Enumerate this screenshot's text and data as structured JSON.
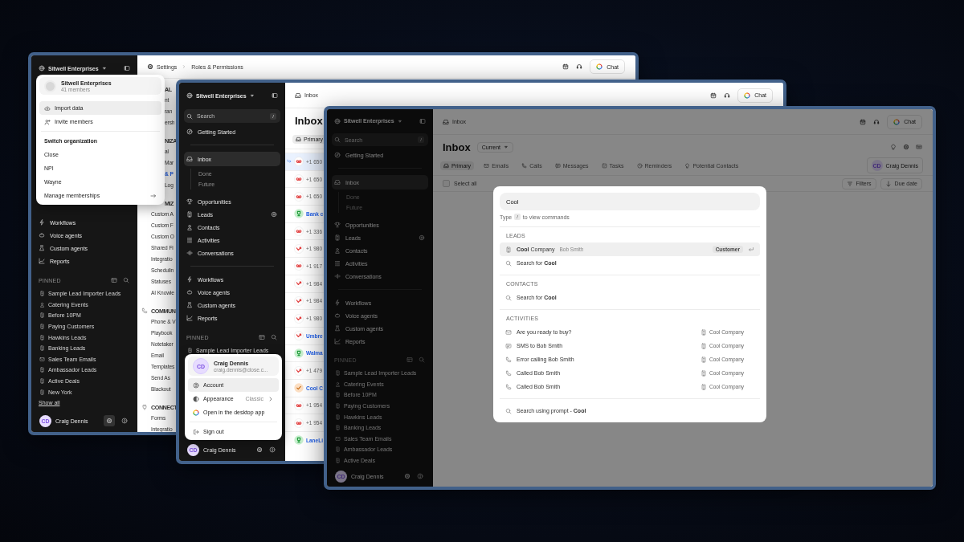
{
  "windows": [
    {
      "kind": "settings",
      "dimmed": false,
      "sidebar": {
        "workspace": "Sitwell Enterprises",
        "nav_groups": [
          {
            "items": [
              {
                "label": "Workflows",
                "kind": "workflows",
                "selected": false
              },
              {
                "label": "Voice agents",
                "kind": "voice_agents",
                "selected": false
              },
              {
                "label": "Custom agents",
                "kind": "custom_agents",
                "selected": false
              },
              {
                "label": "Reports",
                "kind": "reports",
                "selected": false
              }
            ]
          }
        ],
        "pinned_title": "PINNED",
        "pinned": [
          {
            "label": "Sample Lead Importer Leads",
            "kind": "lead_view"
          },
          {
            "label": "Catering Events",
            "kind": "contact_view"
          },
          {
            "label": "Before 10PM",
            "kind": "lead_view"
          },
          {
            "label": "Paying Customers",
            "kind": "lead_view"
          },
          {
            "label": "Hawkins Leads",
            "kind": "lead_view"
          },
          {
            "label": "Banking Leads",
            "kind": "lead_view"
          },
          {
            "label": "Sales Team Emails",
            "kind": "email_view"
          },
          {
            "label": "Ambassador Leads",
            "kind": "lead_view"
          },
          {
            "label": "Active Deals",
            "kind": "lead_view"
          },
          {
            "label": "New York",
            "kind": "lead_view"
          }
        ],
        "show_all": "Show all",
        "user": {
          "name": "Craig Dennis",
          "initials": "CD"
        }
      },
      "breadcrumb": [
        "Settings",
        "Roles & Permissions"
      ],
      "chat": "Chat",
      "settings_nav_top": [
        {
          "kind": "section",
          "label": "AL"
        },
        {
          "kind": "link",
          "label": "nt",
          "selected": false
        },
        {
          "kind": "link",
          "label": "ran",
          "selected": false
        },
        {
          "kind": "link",
          "label": "ersh",
          "selected": false
        },
        {
          "kind": "section",
          "label": "NIZA"
        },
        {
          "kind": "link",
          "label": "al",
          "selected": false
        },
        {
          "kind": "link",
          "label": "Mar",
          "selected": false
        },
        {
          "kind": "link",
          "label": "& P",
          "selected": true
        },
        {
          "kind": "link",
          "label": "Log",
          "selected": false
        },
        {
          "kind": "section",
          "label": "MIZ"
        }
      ],
      "settings_nav": [
        {
          "kind": "link",
          "label": "Custom A",
          "selected": false
        },
        {
          "kind": "link",
          "label": "Custom F",
          "selected": false
        },
        {
          "kind": "link",
          "label": "Custom O",
          "selected": false
        },
        {
          "kind": "link",
          "label": "Shared Fi",
          "selected": false
        },
        {
          "kind": "link",
          "label": "Integratio",
          "selected": false
        },
        {
          "kind": "link",
          "label": "Schedulin",
          "selected": false
        },
        {
          "kind": "link",
          "label": "Statuses",
          "selected": false
        },
        {
          "kind": "link",
          "label": "AI Knowle",
          "selected": false
        },
        {
          "kind": "communication_section",
          "label": "COMMUNI"
        },
        {
          "kind": "link",
          "label": "Phone & V",
          "selected": false
        },
        {
          "kind": "link",
          "label": "Playbook",
          "selected": false
        },
        {
          "kind": "link",
          "label": "Notetaker",
          "selected": false
        },
        {
          "kind": "link",
          "label": "Email",
          "selected": false
        },
        {
          "kind": "link",
          "label": "Templates",
          "selected": false
        },
        {
          "kind": "link",
          "label": "Send As",
          "selected": false
        },
        {
          "kind": "link",
          "label": "Blackout",
          "selected": false
        },
        {
          "kind": "connect_section",
          "label": "CONNECT"
        },
        {
          "kind": "link",
          "label": "Forms",
          "selected": false
        },
        {
          "kind": "link",
          "label": "Integratio",
          "selected": false
        }
      ],
      "workspace_menu": {
        "title": "Sitwell Enterprises",
        "subtitle": "41 members",
        "actions": [
          {
            "label": "Import data",
            "kind": "import",
            "selected": true
          },
          {
            "label": "Invite members",
            "kind": "invite",
            "selected": false
          }
        ],
        "heading": "Switch organization",
        "organizations": [
          "Close",
          "NPI",
          "Wayne"
        ],
        "manage": "Manage memberships"
      }
    },
    {
      "kind": "inbox",
      "dimmed": false,
      "sidebar": {
        "workspace": "Sitwell Enterprises",
        "search": "Search",
        "search_key": "/",
        "nav_groups": [
          {
            "items": [
              {
                "label": "Getting Started",
                "kind": "getting_started",
                "selected": false
              }
            ]
          },
          {
            "items": [
              {
                "label": "Inbox",
                "kind": "inbox",
                "selected": true,
                "children": [
                  {
                    "label": "Done",
                    "selected": false
                  },
                  {
                    "label": "Future",
                    "selected": false
                  }
                ]
              },
              {
                "label": "Opportunities",
                "kind": "opportunities",
                "selected": false
              },
              {
                "label": "Leads",
                "kind": "leads",
                "selected": false
              },
              {
                "label": "Contacts",
                "kind": "contacts",
                "selected": false
              },
              {
                "label": "Activities",
                "kind": "activities",
                "selected": false
              },
              {
                "label": "Conversations",
                "kind": "conversations",
                "selected": false
              }
            ]
          },
          {
            "items": [
              {
                "label": "Workflows",
                "kind": "workflows",
                "selected": false
              },
              {
                "label": "Voice agents",
                "kind": "voice_agents",
                "selected": false
              },
              {
                "label": "Custom agents",
                "kind": "custom_agents",
                "selected": false
              },
              {
                "label": "Reports",
                "kind": "reports",
                "selected": false
              }
            ]
          }
        ],
        "pinned_title": "PINNED",
        "pinned": [
          {
            "label": "Sample Lead Importer Leads",
            "kind": "lead_view"
          }
        ],
        "user": {
          "name": "Craig Dennis",
          "initials": "CD"
        }
      },
      "breadcrumb": [
        "Inbox"
      ],
      "chat": "Chat",
      "page_title": "Inbox",
      "tabs": [
        {
          "label": "Primary",
          "kind": "primary",
          "selected": true
        }
      ],
      "rows": [
        {
          "kind": "voicemail",
          "text": "+1 650",
          "link": false,
          "selected": true
        },
        {
          "kind": "voicemail",
          "text": "+1 650",
          "link": false,
          "selected": false
        },
        {
          "kind": "voicemail",
          "text": "+1 650",
          "link": false,
          "selected": false
        },
        {
          "kind": "opportunity",
          "text": "Bank c",
          "link": true,
          "selected": false
        },
        {
          "kind": "voicemail",
          "text": "+1 336",
          "link": false,
          "selected": false
        },
        {
          "kind": "missed_call",
          "text": "+1 980",
          "link": false,
          "selected": false
        },
        {
          "kind": "voicemail",
          "text": "+1 917",
          "link": false,
          "selected": false
        },
        {
          "kind": "missed_call",
          "text": "+1 984",
          "link": false,
          "selected": false
        },
        {
          "kind": "missed_call",
          "text": "+1 984",
          "link": false,
          "selected": false
        },
        {
          "kind": "missed_call",
          "text": "+1 980",
          "link": false,
          "selected": false
        },
        {
          "kind": "missed_call",
          "text": "Umbre",
          "link": true,
          "selected": false
        },
        {
          "kind": "opportunity",
          "text": "Walma",
          "link": true,
          "selected": false
        },
        {
          "kind": "missed_call",
          "text": "+1 479",
          "link": false,
          "selected": false
        },
        {
          "kind": "task",
          "text": "Cool C",
          "link": true,
          "selected": false
        },
        {
          "kind": "voicemail",
          "text": "+1 954",
          "link": false,
          "selected": false
        },
        {
          "kind": "voicemail",
          "text": "+1 954",
          "link": false,
          "selected": false
        },
        {
          "kind": "opportunity",
          "text": "LaneLi",
          "link": true,
          "selected": false
        }
      ],
      "user_menu": {
        "name": "Craig Dennis",
        "initials": "CD",
        "email": "craig.dennis@close.c...",
        "items": [
          {
            "label": "Account",
            "kind": "account",
            "selected": true
          },
          {
            "label": "Appearance",
            "kind": "appearance",
            "value": "Classic",
            "selected": false
          },
          {
            "label": "Open in the desktop app",
            "kind": "desktop",
            "selected": false
          },
          {
            "label": "Sign out",
            "kind": "sign_out",
            "selected": false
          }
        ]
      }
    },
    {
      "kind": "inbox",
      "dimmed": true,
      "sidebar": {
        "workspace": "Sitwell Enterprises",
        "search": "Search",
        "search_key": "/",
        "nav_groups": [
          {
            "items": [
              {
                "label": "Getting Started",
                "kind": "getting_started",
                "selected": false
              }
            ]
          },
          {
            "items": [
              {
                "label": "Inbox",
                "kind": "inbox",
                "selected": true,
                "children": [
                  {
                    "label": "Done",
                    "selected": false
                  },
                  {
                    "label": "Future",
                    "selected": false
                  }
                ]
              },
              {
                "label": "Opportunities",
                "kind": "opportunities",
                "selected": false
              },
              {
                "label": "Leads",
                "kind": "leads",
                "selected": false
              },
              {
                "label": "Contacts",
                "kind": "contacts",
                "selected": false
              },
              {
                "label": "Activities",
                "kind": "activities",
                "selected": false
              },
              {
                "label": "Conversations",
                "kind": "conversations",
                "selected": false
              }
            ]
          },
          {
            "items": [
              {
                "label": "Workflows",
                "kind": "workflows",
                "selected": false
              },
              {
                "label": "Voice agents",
                "kind": "voice_agents",
                "selected": false
              },
              {
                "label": "Custom agents",
                "kind": "custom_agents",
                "selected": false
              },
              {
                "label": "Reports",
                "kind": "reports",
                "selected": false
              }
            ]
          }
        ],
        "pinned_title": "PINNED",
        "pinned": [
          {
            "label": "Sample Lead Importer Leads",
            "kind": "lead_view"
          },
          {
            "label": "Catering Events",
            "kind": "contact_view"
          },
          {
            "label": "Before 10PM",
            "kind": "lead_view"
          },
          {
            "label": "Paying Customers",
            "kind": "lead_view"
          },
          {
            "label": "Hawkins Leads",
            "kind": "lead_view"
          },
          {
            "label": "Banking Leads",
            "kind": "lead_view"
          },
          {
            "label": "Sales Team Emails",
            "kind": "email_view"
          },
          {
            "label": "Ambassador Leads",
            "kind": "lead_view"
          },
          {
            "label": "Active Deals",
            "kind": "lead_view"
          }
        ],
        "user": {
          "name": "Craig Dennis",
          "initials": "CD"
        }
      },
      "breadcrumb": [
        "Inbox"
      ],
      "chat": "Chat",
      "page_title": "Inbox",
      "view_menu": "Current",
      "tabs": [
        {
          "label": "Primary",
          "kind": "primary",
          "selected": true
        },
        {
          "label": "Emails",
          "kind": "emails",
          "selected": false
        },
        {
          "label": "Calls",
          "kind": "calls",
          "selected": false
        },
        {
          "label": "Messages",
          "kind": "messages",
          "selected": false
        },
        {
          "label": "Tasks",
          "kind": "tasks",
          "selected": false
        },
        {
          "label": "Reminders",
          "kind": "reminders",
          "selected": false
        },
        {
          "label": "Potential Contacts",
          "kind": "potential_contacts",
          "selected": false
        }
      ],
      "assignee": {
        "name": "Craig Dennis",
        "initials": "CD"
      },
      "select_all": {
        "label": "Select all",
        "checked": false
      },
      "filters": "Filters",
      "sort": "Due date",
      "command_palette": {
        "query": "Cool",
        "hint_before": "Type",
        "hint_key": "/",
        "hint_after": "to view commands",
        "sections": [
          {
            "title": "LEADS",
            "items": [
              {
                "kind": "lead",
                "text": "**Cool** Company",
                "secondary": "Bob Smith",
                "badge": "Customer",
                "selected": true
              },
              {
                "kind": "search",
                "text": "Search for **Cool**",
                "selected": false
              }
            ]
          },
          {
            "title": "CONTACTS",
            "items": [
              {
                "kind": "search",
                "text": "Search for **Cool**",
                "selected": false
              }
            ]
          },
          {
            "title": "ACTIVITIES",
            "items": [
              {
                "kind": "email",
                "text": "Are you ready to buy?",
                "context": "Cool Company",
                "selected": false
              },
              {
                "kind": "sms",
                "text": "SMS to Bob Smith",
                "context": "Cool Company",
                "selected": false
              },
              {
                "kind": "call",
                "text": "Error calling Bob Smith",
                "context": "Cool Company",
                "selected": false
              },
              {
                "kind": "call",
                "text": "Called Bob Smith",
                "context": "Cool Company",
                "selected": false
              },
              {
                "kind": "call",
                "text": "Called Bob Smith",
                "context": "Cool Company",
                "selected": false
              }
            ]
          }
        ],
        "footer": "Search using prompt  -  **Cool**"
      }
    }
  ]
}
